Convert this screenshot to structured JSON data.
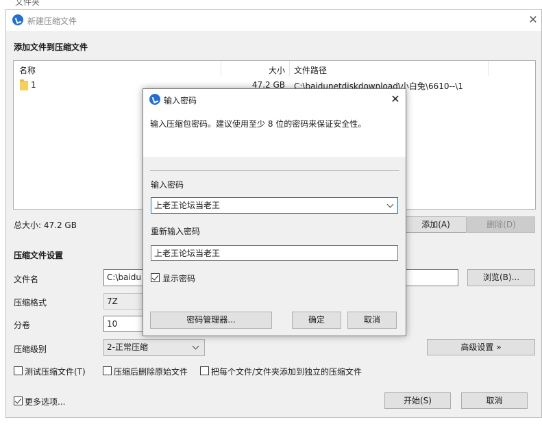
{
  "background_window": {
    "title_fragment": "文件夹"
  },
  "main_window": {
    "title": "新建压缩文件",
    "add_section_label": "添加文件到压缩文件",
    "table": {
      "columns": [
        "名称",
        "大小",
        "文件路径"
      ],
      "rows": [
        {
          "name": "1",
          "size": "47.2 GB",
          "path": "C:\\baidunetdiskdownload\\小白兔\\6610--\\1"
        }
      ]
    },
    "total_size": "总大小: 47.2 GB",
    "add_button": "添加(A)",
    "delete_button": "删除(D)",
    "settings_label": "压缩文件设置",
    "filename_label": "文件名",
    "filename_value": "C:\\baidu",
    "browse_button": "浏览(B)...",
    "format_label": "压缩格式",
    "format_value": "7Z",
    "volume_label": "分卷",
    "volume_value": "10",
    "level_label": "压缩级别",
    "level_value": "2-正常压缩",
    "advanced_button": "高级设置 »",
    "test_checkbox": "测试压缩文件(T)",
    "delete_after_checkbox": "压缩后删除原始文件",
    "separate_checkbox": "把每个文件/文件夹添加到独立的压缩文件",
    "more_options_checkbox": "更多选项...",
    "start_button": "开始(S)",
    "cancel_button": "取消"
  },
  "password_dialog": {
    "title": "输入密码",
    "info": "输入压缩包密码。建议使用至少 8 位的密码来保证安全性。",
    "password_label": "输入密码",
    "password_value": "上老王论坛当老王",
    "confirm_label": "重新输入密码",
    "confirm_value": "上老王论坛当老王",
    "show_password": "显示密码",
    "manager_button": "密码管理器...",
    "ok_button": "确定",
    "cancel_button": "取消"
  },
  "colors": {
    "accent": "#0078d7",
    "app_icon": "#1f6fd6",
    "folder": "#f6cf57"
  }
}
